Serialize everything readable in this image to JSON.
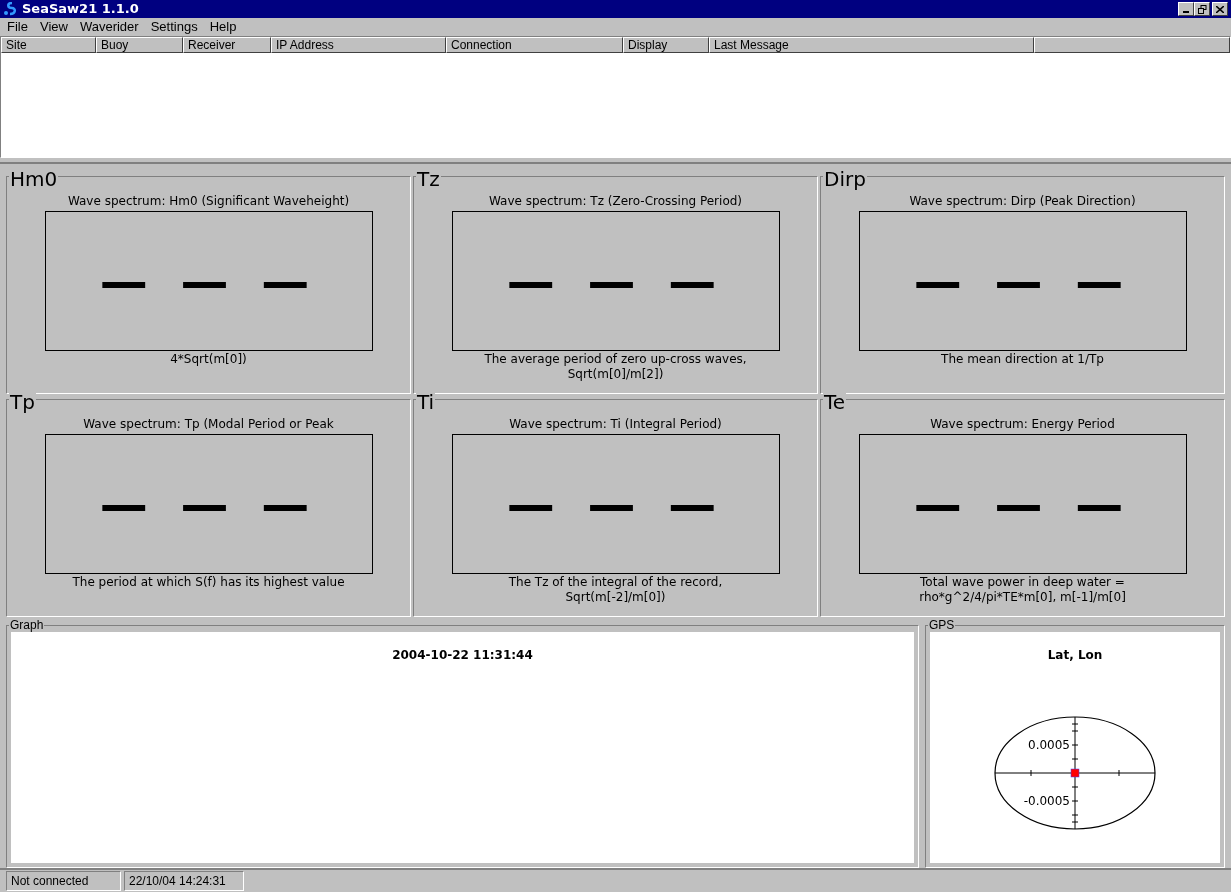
{
  "window": {
    "title": "SeaSaw21 1.1.0"
  },
  "menu": [
    {
      "label": "File"
    },
    {
      "label": "View"
    },
    {
      "label": "Waverider"
    },
    {
      "label": "Settings"
    },
    {
      "label": "Help"
    }
  ],
  "list": {
    "columns": [
      "Site",
      "Buoy",
      "Receiver",
      "IP Address",
      "Connection",
      "Display",
      "Last Message"
    ]
  },
  "panels": [
    {
      "name": "Hm0",
      "title": "Wave spectrum: Hm0 (Significant Waveheight)",
      "value": "— — —",
      "description": "4*Sqrt(m[0])"
    },
    {
      "name": "Tz",
      "title": "Wave spectrum: Tz (Zero-Crossing Period)",
      "value": "— — —",
      "description": "The average period of zero up-cross waves, Sqrt(m[0]/m[2])"
    },
    {
      "name": "Dirp",
      "title": "Wave spectrum: Dirp (Peak Direction)",
      "value": "— — —",
      "description": "The mean direction at 1/Tp"
    },
    {
      "name": "Tp",
      "title": "Wave spectrum: Tp (Modal Period or Peak",
      "value": "— — —",
      "description": "The period at which S(f) has its highest value"
    },
    {
      "name": "Ti",
      "title": "Wave spectrum: Ti (Integral Period)",
      "value": "— — —",
      "description": "The Tz of the integral of the record, Sqrt(m[-2]/m[0])"
    },
    {
      "name": "Te",
      "title": "Wave spectrum: Energy Period",
      "value": "— — —",
      "description": "Total wave power in deep water = rho*g^2/4/pi*TE*m[0], m[-1]/m[0]"
    }
  ],
  "graph": {
    "label": "Graph",
    "title": "2004-10-22 11:31:44"
  },
  "gps": {
    "label": "GPS",
    "title": "Lat, Lon",
    "tick_labels": [
      "0.0005",
      "-0.0005"
    ]
  },
  "status_bar": [
    "Not connected",
    "22/10/04 14:24:31"
  ]
}
